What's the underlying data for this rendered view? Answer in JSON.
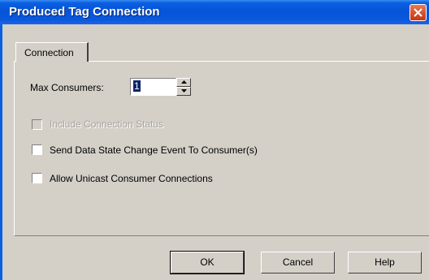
{
  "window": {
    "title": "Produced Tag Connection"
  },
  "tabs": [
    {
      "label": "Connection",
      "selected": true
    }
  ],
  "connection": {
    "max_consumers_label": "Max Consumers:",
    "max_consumers_value": "1",
    "include_status_label": "Include Connection Status",
    "include_status_checked": false,
    "include_status_enabled": false,
    "send_event_label": "Send Data State Change Event To Consumer(s)",
    "send_event_checked": false,
    "allow_unicast_label": "Allow Unicast Consumer Connections",
    "allow_unicast_checked": false
  },
  "buttons": {
    "ok": "OK",
    "cancel": "Cancel",
    "help": "Help"
  },
  "colors": {
    "titlebar": "#0554d8",
    "dialog_face": "#d4d0c8",
    "close_button": "#d9532c",
    "selection": "#0a246a"
  }
}
